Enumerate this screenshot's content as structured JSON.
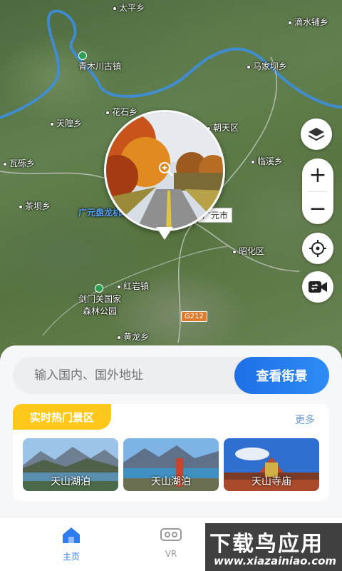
{
  "map": {
    "places": [
      {
        "name": "太平乡"
      },
      {
        "name": "滴水铺乡"
      },
      {
        "name": "青木川古镇"
      },
      {
        "name": "马家坝乡"
      },
      {
        "name": "花石乡"
      },
      {
        "name": "天隍乡"
      },
      {
        "name": "朝天区"
      },
      {
        "name": "瓦砾乡"
      },
      {
        "name": "临溪乡"
      },
      {
        "name": "茶坝乡"
      },
      {
        "name": "广元盘龙机场"
      },
      {
        "name": "昭化区"
      },
      {
        "name": "红岩镇"
      },
      {
        "name": "剑门关国家"
      },
      {
        "name": "森林公园"
      },
      {
        "name": "黄龙乡"
      }
    ],
    "road_shield": "G212",
    "city_label": "广元市",
    "controls": {
      "layers": "layers-icon",
      "zoom_in": "+",
      "zoom_out": "−",
      "locate": "crosshair-icon",
      "streetview_cam": "video-camera-icon"
    }
  },
  "search": {
    "placeholder": "输入国内、国外地址",
    "button": "查看街景"
  },
  "hot": {
    "title": "实时热门景区",
    "more": "更多",
    "items": [
      {
        "caption": "天山湖泊"
      },
      {
        "caption": "天山湖泊"
      },
      {
        "caption": "天山寺庙"
      }
    ]
  },
  "nav": {
    "home": "主页",
    "vr": "VR"
  },
  "watermark": {
    "title": "下载鸟应用",
    "url": "www.xiazainiao.com"
  },
  "colors": {
    "accent": "#2e7cf0",
    "tag": "#ffc81a",
    "route": "#3b8fe8"
  }
}
